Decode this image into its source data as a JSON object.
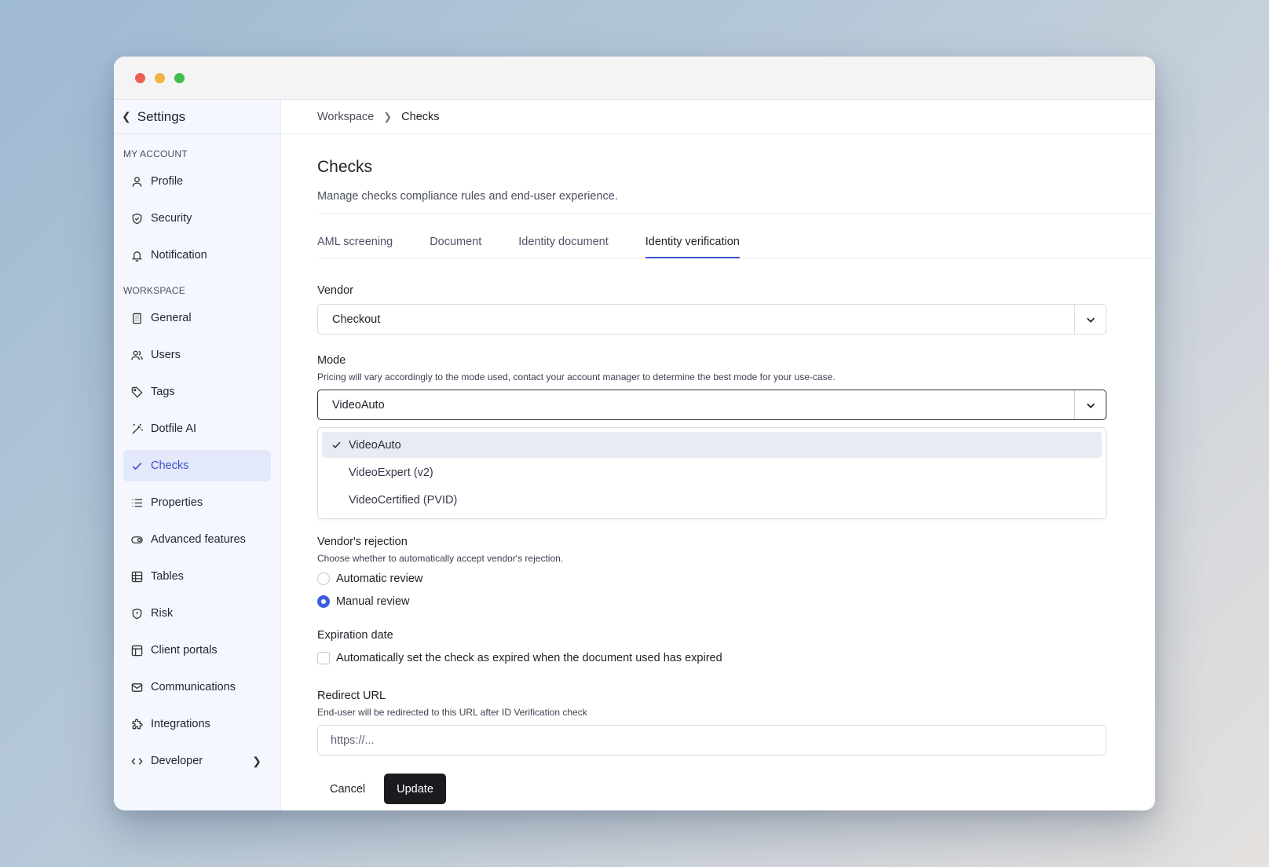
{
  "sidebar": {
    "back_label": "Settings",
    "section_account": "MY ACCOUNT",
    "section_workspace": "WORKSPACE",
    "account_items": [
      {
        "label": "Profile",
        "icon": "user-icon"
      },
      {
        "label": "Security",
        "icon": "shield-check-icon"
      },
      {
        "label": "Notification",
        "icon": "bell-icon"
      }
    ],
    "workspace_items": [
      {
        "label": "General",
        "icon": "building-icon"
      },
      {
        "label": "Users",
        "icon": "users-icon"
      },
      {
        "label": "Tags",
        "icon": "tag-icon"
      },
      {
        "label": "Dotfile AI",
        "icon": "magic-wand-icon"
      },
      {
        "label": "Checks",
        "icon": "check-icon",
        "active": true
      },
      {
        "label": "Properties",
        "icon": "list-icon"
      },
      {
        "label": "Advanced features",
        "icon": "toggle-icon"
      },
      {
        "label": "Tables",
        "icon": "table-icon"
      },
      {
        "label": "Risk",
        "icon": "shield-alert-icon"
      },
      {
        "label": "Client portals",
        "icon": "layout-icon"
      },
      {
        "label": "Communications",
        "icon": "mail-icon"
      },
      {
        "label": "Integrations",
        "icon": "puzzle-icon"
      },
      {
        "label": "Developer",
        "icon": "code-icon"
      }
    ]
  },
  "breadcrumb": {
    "parent": "Workspace",
    "current": "Checks"
  },
  "page": {
    "title": "Checks",
    "description": "Manage checks compliance rules and end-user experience."
  },
  "tabs": [
    "AML screening",
    "Document",
    "Identity document",
    "Identity verification"
  ],
  "active_tab": "Identity verification",
  "form": {
    "vendor": {
      "label": "Vendor",
      "value": "Checkout"
    },
    "mode": {
      "label": "Mode",
      "hint": "Pricing will vary accordingly to the mode used, contact your account manager to determine the best mode for your use-case.",
      "value": "VideoAuto",
      "options": [
        "VideoAuto",
        "VideoExpert (v2)",
        "VideoCertified (PVID)"
      ]
    },
    "rejection": {
      "label": "Vendor's rejection",
      "hint": "Choose whether to automatically accept vendor's rejection.",
      "options": [
        "Automatic review",
        "Manual review"
      ],
      "selected": "Manual review"
    },
    "expiration": {
      "label": "Expiration date",
      "checkbox_label": "Automatically set the check as expired when the document used has expired",
      "checked": false
    },
    "redirect": {
      "label": "Redirect URL",
      "hint": "End-user will be redirected to this URL after ID Verification check",
      "placeholder": "https://..."
    },
    "cancel_label": "Cancel",
    "update_label": "Update"
  },
  "colors": {
    "accent": "#3b4fc9",
    "radio": "#3d5de0",
    "primary_button": "#1a1b1f"
  }
}
